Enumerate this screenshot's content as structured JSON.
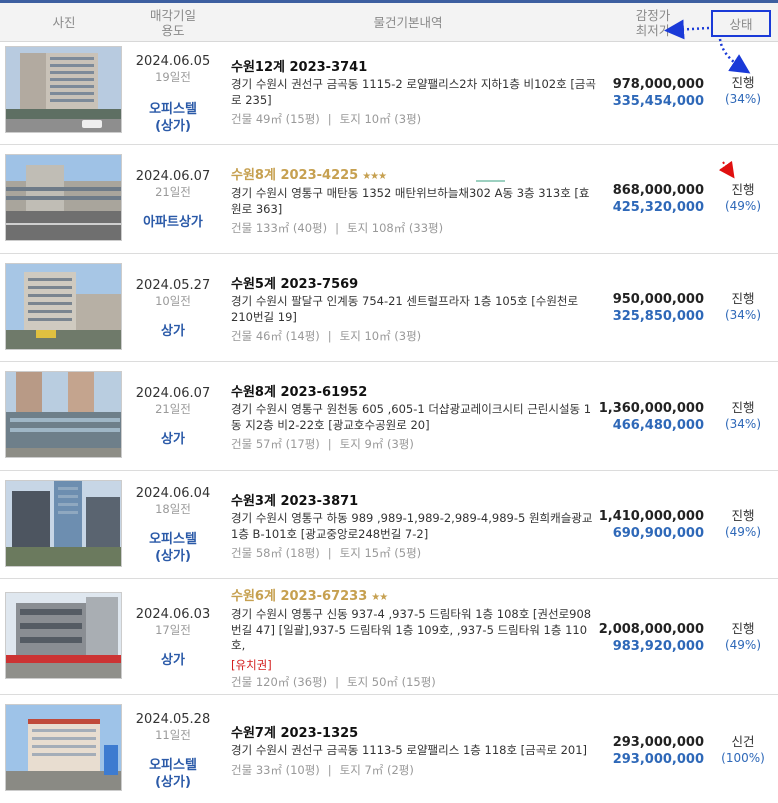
{
  "header": {
    "photo": "사진",
    "date_line1": "매각기일",
    "date_line2": "용도",
    "info": "물건기본내역",
    "price_line1": "감정가",
    "price_line2": "최저가",
    "status": "상태"
  },
  "colors": {
    "accent": "#2e68b8",
    "annotation": "#1a3ad8",
    "gold": "#c6a050",
    "warning": "#d42020"
  },
  "items": [
    {
      "date": "2024.06.05",
      "ago": "19일전",
      "use1": "오피스텔",
      "use2": "(상가)",
      "case": "수원12계 2023-3741",
      "stars": "",
      "addr": "경기 수원시 권선구 금곡동 1115-2 로얄팰리스2차 지하1층 비102호 [금곡로 235]",
      "building": "건물 49㎡ (15평)",
      "land": "토지 10㎡ (3평)",
      "tag": "",
      "appraisal": "978,000,000",
      "minimum": "335,454,000",
      "status": "진행",
      "percent": "(34%)"
    },
    {
      "date": "2024.06.07",
      "ago": "21일전",
      "use1": "아파트상가",
      "use2": "",
      "case": "수원8계 2023-4225",
      "stars": "★★★",
      "addr": "경기 수원시 영통구 매탄동 1352 매탄위브하늘채302 A동 3층 313호 [효원로 363]",
      "building": "건물 133㎡ (40평)",
      "land": "토지 108㎡ (33평)",
      "tag": "",
      "appraisal": "868,000,000",
      "minimum": "425,320,000",
      "status": "진행",
      "percent": "(49%)"
    },
    {
      "date": "2024.05.27",
      "ago": "10일전",
      "use1": "상가",
      "use2": "",
      "case": "수원5계 2023-7569",
      "stars": "",
      "addr": "경기 수원시 팔달구 인계동 754-21 센트럴프라자 1층 105호 [수원천로210번길 19]",
      "building": "건물 46㎡ (14평)",
      "land": "토지 10㎡ (3평)",
      "tag": "",
      "appraisal": "950,000,000",
      "minimum": "325,850,000",
      "status": "진행",
      "percent": "(34%)"
    },
    {
      "date": "2024.06.07",
      "ago": "21일전",
      "use1": "상가",
      "use2": "",
      "case": "수원8계 2023-61952",
      "stars": "",
      "addr": "경기 수원시 영통구 원천동 605 ,605-1 더샵광교레이크시티 근린시설동 1동 지2층 비2-22호 [광교호수공원로 20]",
      "building": "건물 57㎡ (17평)",
      "land": "토지 9㎡ (3평)",
      "tag": "",
      "appraisal": "1,360,000,000",
      "minimum": "466,480,000",
      "status": "진행",
      "percent": "(34%)"
    },
    {
      "date": "2024.06.04",
      "ago": "18일전",
      "use1": "오피스텔",
      "use2": "(상가)",
      "case": "수원3계 2023-3871",
      "stars": "",
      "addr": "경기 수원시 영통구 하동 989 ,989-1,989-2,989-4,989-5 원희캐슬광교 1층 B-101호 [광교중앙로248번길 7-2]",
      "building": "건물 58㎡ (18평)",
      "land": "토지 15㎡ (5평)",
      "tag": "",
      "appraisal": "1,410,000,000",
      "minimum": "690,900,000",
      "status": "진행",
      "percent": "(49%)"
    },
    {
      "date": "2024.06.03",
      "ago": "17일전",
      "use1": "상가",
      "use2": "",
      "case": "수원6계 2023-67233",
      "stars": "★★",
      "addr": "경기 수원시 영통구 신동 937-4 ,937-5 드림타워 1층 108호 [권선로908번길 47] [일괄],937-5 드림타워 1층 109호, ,937-5 드림타워 1층 110호,",
      "building": "건물 120㎡ (36평)",
      "land": "토지 50㎡ (15평)",
      "tag": "[유치권]",
      "appraisal": "2,008,000,000",
      "minimum": "983,920,000",
      "status": "진행",
      "percent": "(49%)"
    },
    {
      "date": "2024.05.28",
      "ago": "11일전",
      "use1": "오피스텔",
      "use2": "(상가)",
      "case": "수원7계 2023-1325",
      "stars": "",
      "addr": "경기 수원시 권선구 금곡동 1113-5 로얄팰리스 1층 118호 [금곡로 201]",
      "building": "건물 33㎡ (10평)",
      "land": "토지 7㎡ (2평)",
      "tag": "",
      "appraisal": "293,000,000",
      "minimum": "293,000,000",
      "status": "신건",
      "percent": "(100%)"
    }
  ]
}
